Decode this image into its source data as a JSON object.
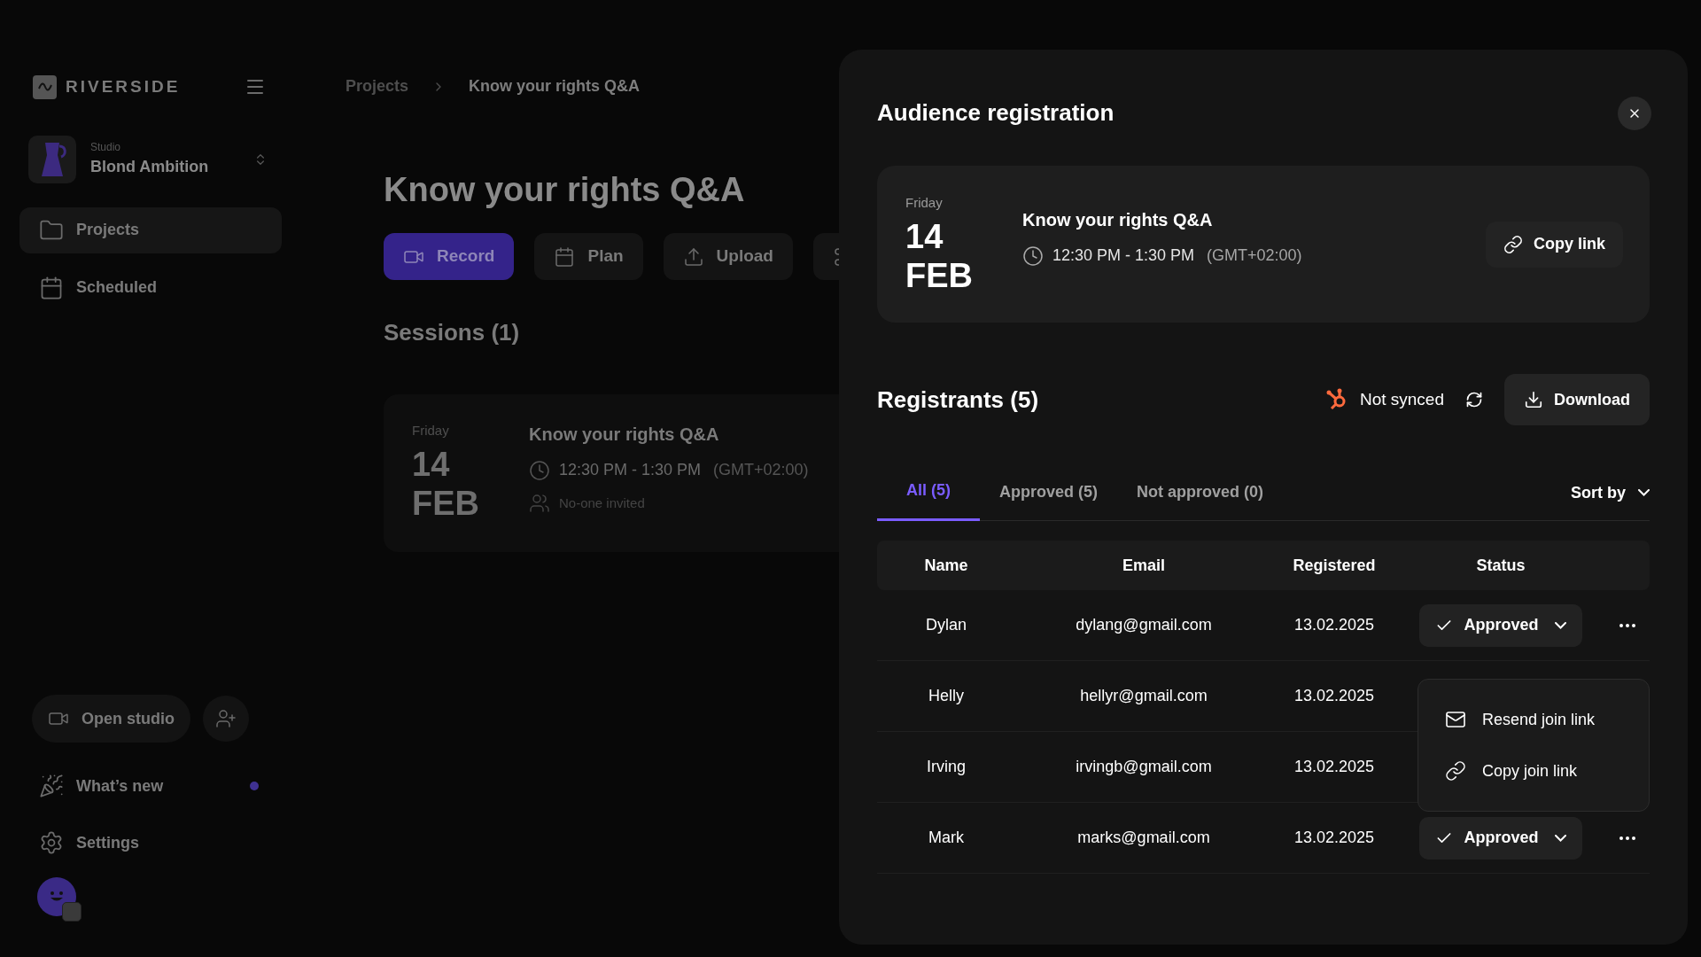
{
  "sidebar": {
    "logo": "RIVERSIDE",
    "studio": {
      "label": "Studio",
      "name": "Blond Ambition"
    },
    "nav": [
      {
        "label": "Projects",
        "selected": true
      },
      {
        "label": "Scheduled",
        "selected": false
      }
    ],
    "open_studio": "Open studio",
    "bottom": [
      {
        "label": "What’s new",
        "unread": true
      },
      {
        "label": "Settings",
        "unread": false
      }
    ]
  },
  "breadcrumb": [
    "Projects",
    "Know your rights Q&A"
  ],
  "project": {
    "title": "Know your rights Q&A",
    "actions": [
      {
        "label": "Record",
        "primary": true
      },
      {
        "label": "Plan",
        "primary": false
      },
      {
        "label": "Upload",
        "primary": false
      },
      {
        "primary": false
      }
    ],
    "sessions_heading": "Sessions (1)",
    "session": {
      "weekday": "Friday",
      "day": "14",
      "month": "FEB",
      "title": "Know your rights Q&A",
      "time": "12:30 PM - 1:30 PM",
      "timezone": "(GMT+02:00)",
      "invited": "No-one invited"
    }
  },
  "modal": {
    "title": "Audience registration",
    "event": {
      "weekday": "Friday",
      "day": "14",
      "month": "FEB",
      "title": "Know your rights Q&A",
      "time": "12:30 PM - 1:30 PM",
      "timezone": "(GMT+02:00)",
      "copy_link": "Copy link"
    },
    "registrants_heading": "Registrants (5)",
    "sync_status": "Not synced",
    "download": "Download",
    "tabs": [
      {
        "label": "All (5)",
        "selected": true
      },
      {
        "label": "Approved (5)",
        "selected": false
      },
      {
        "label": "Not approved (0)",
        "selected": false
      }
    ],
    "sort": "Sort by",
    "columns": [
      "Name",
      "Email",
      "Registered",
      "Status"
    ],
    "rows": [
      {
        "name": "Dylan",
        "email": "dylang@gmail.com",
        "registered": "13.02.2025",
        "status": "Approved"
      },
      {
        "name": "Helly",
        "email": "hellyr@gmail.com",
        "registered": "13.02.2025"
      },
      {
        "name": "Irving",
        "email": "irvingb@gmail.com",
        "registered": "13.02.2025"
      },
      {
        "name": "Mark",
        "email": "marks@gmail.com",
        "registered": "13.02.2025",
        "status": "Approved"
      }
    ],
    "row_menu": [
      {
        "label": "Resend join link"
      },
      {
        "label": "Copy join link"
      }
    ]
  }
}
